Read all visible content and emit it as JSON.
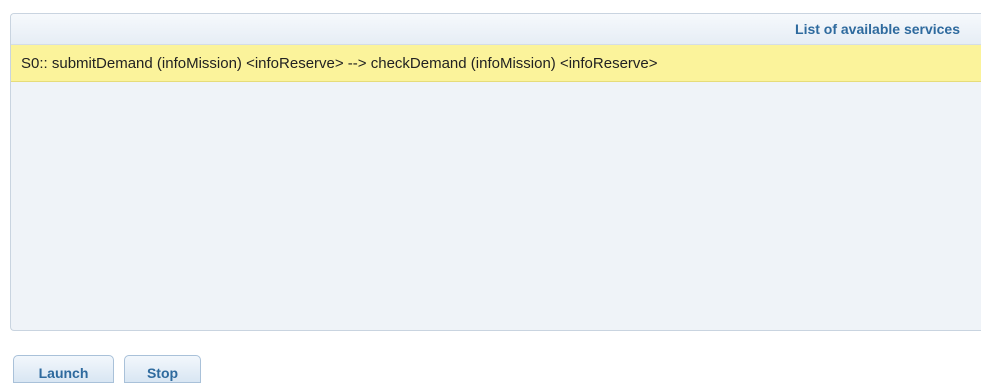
{
  "panel": {
    "title": "List of available services"
  },
  "services": [
    {
      "label": "S0:: submitDemand (infoMission) <infoReserve> --> checkDemand (infoMission) <infoReserve>",
      "selected": true
    }
  ],
  "buttons": {
    "launch_label": "Launch",
    "stop_label": "Stop"
  },
  "colors": {
    "header_text": "#2e6a9e",
    "selected_row": "#fbf39b",
    "panel_bg": "#eff3f8"
  }
}
